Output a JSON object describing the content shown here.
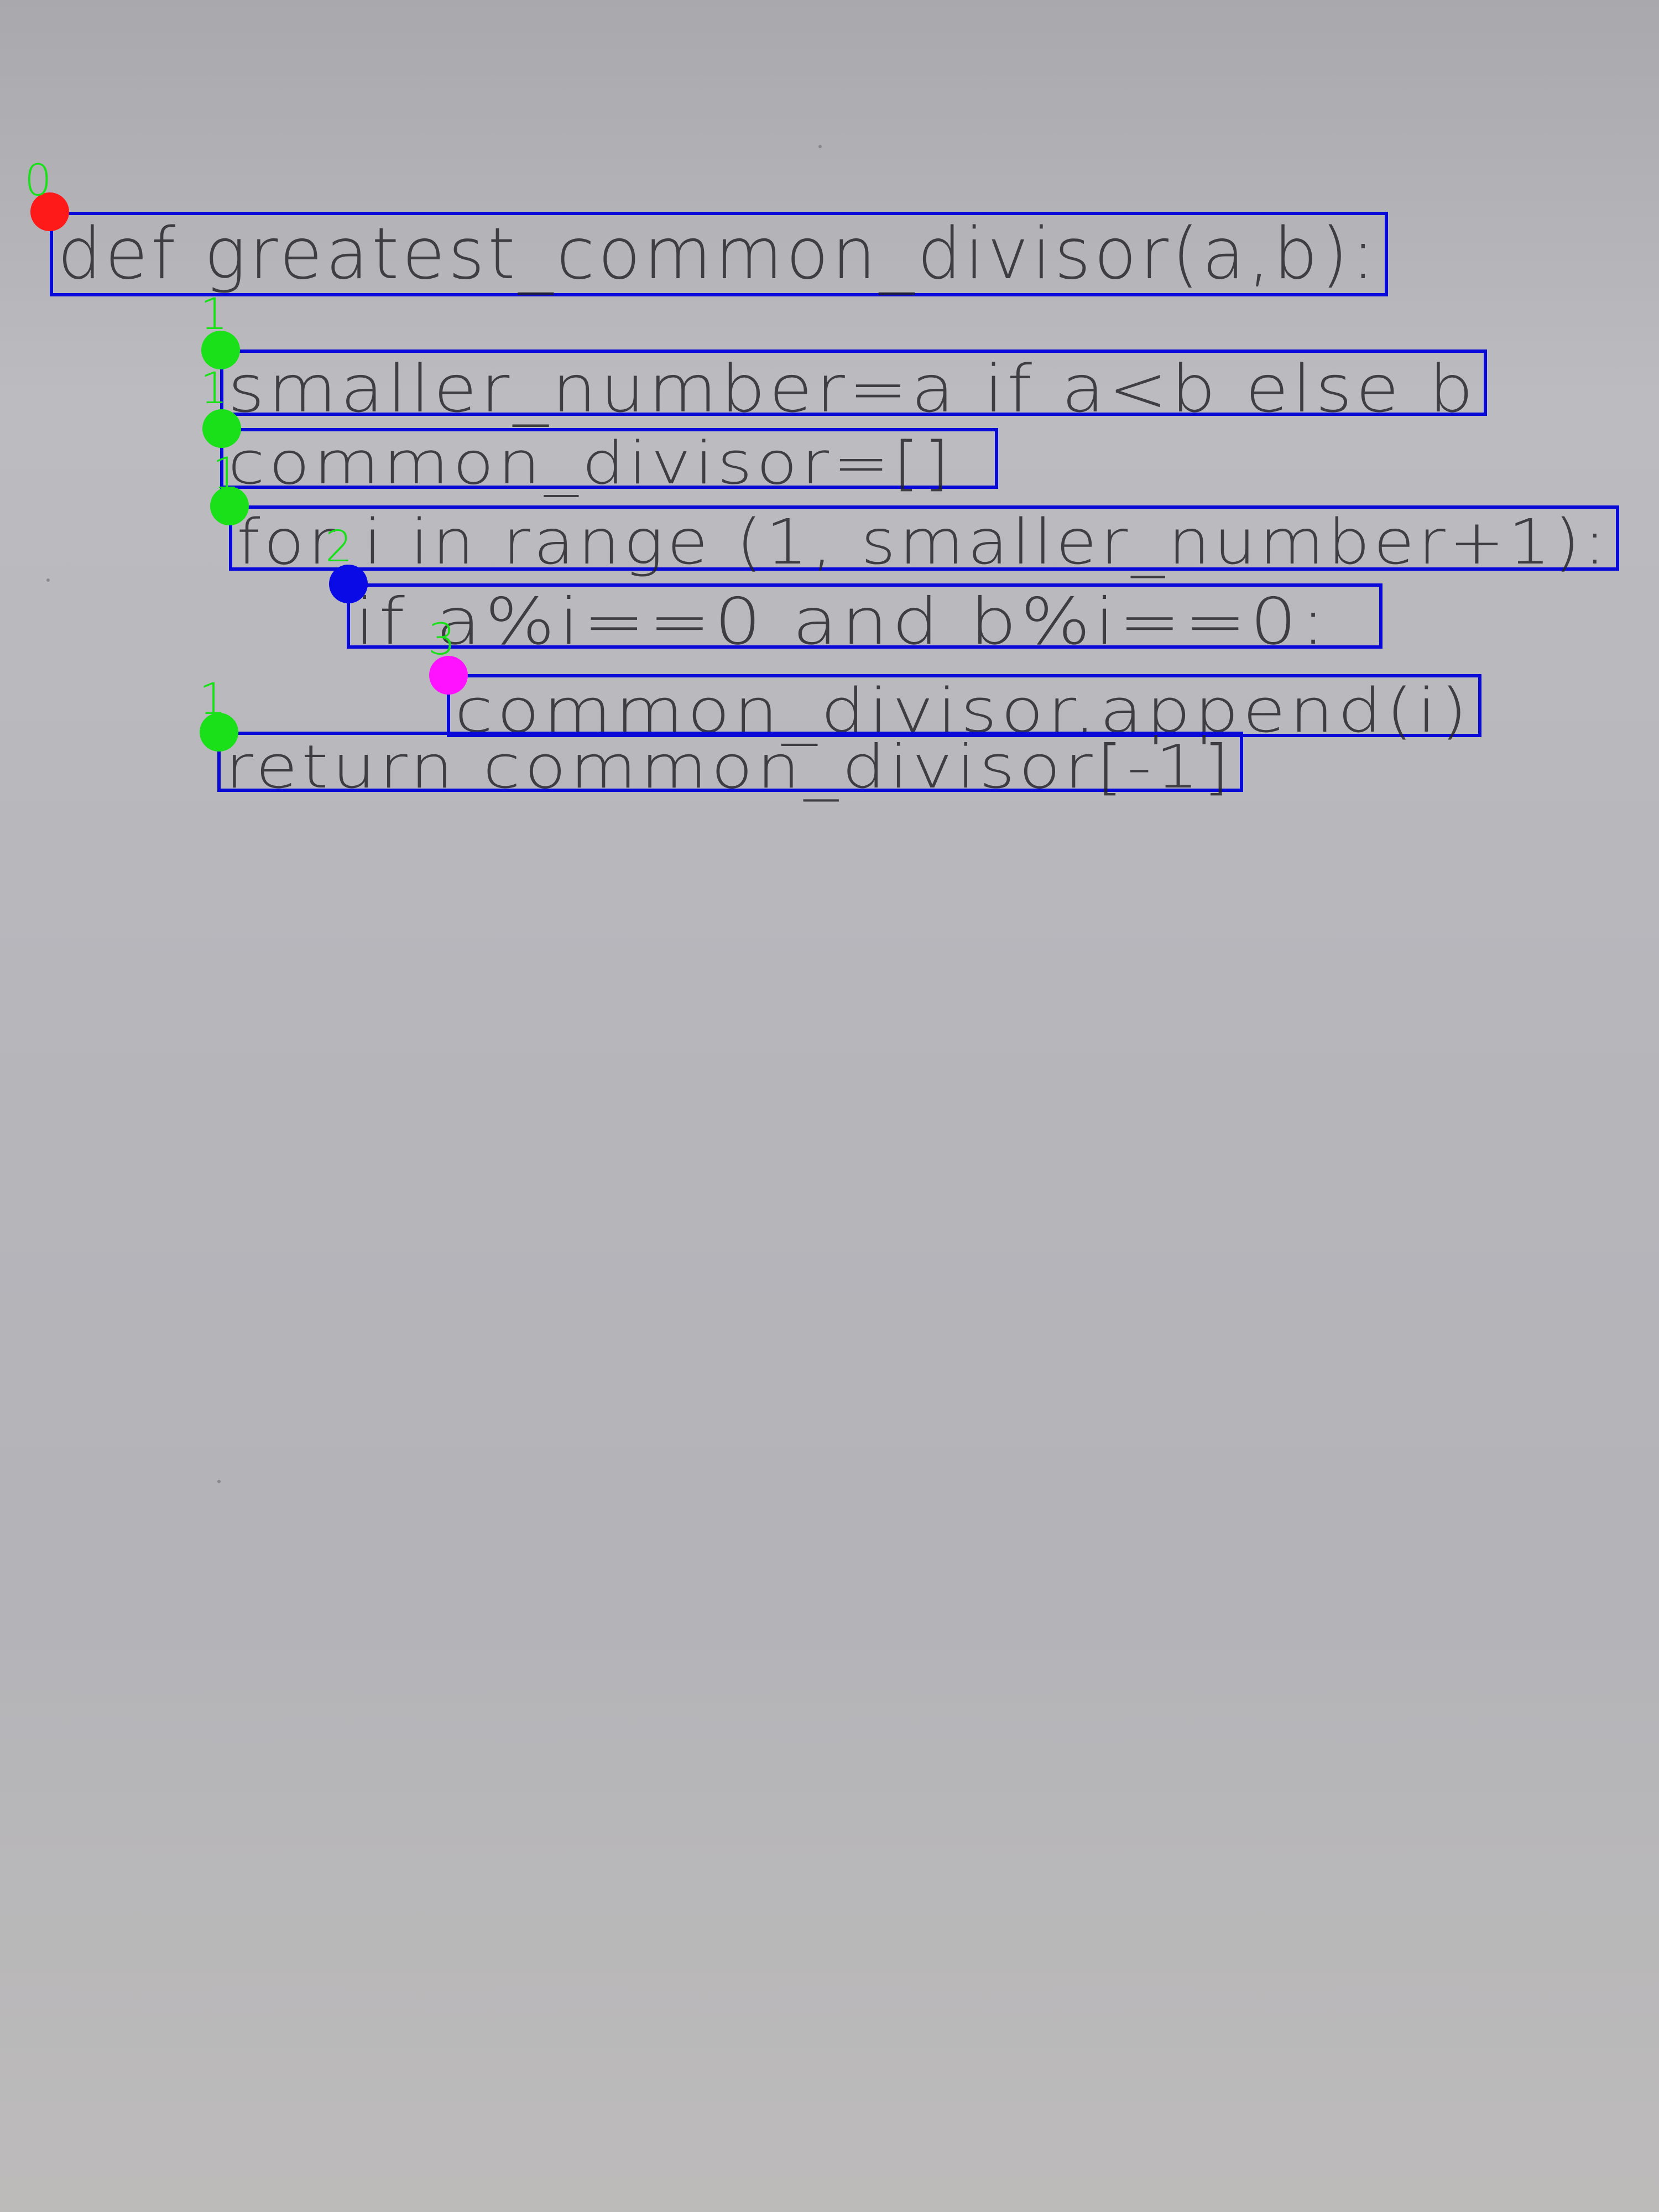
{
  "document": {
    "lines": [
      {
        "text": "def greatest_common_divisor(a,b):",
        "indent_level": "0",
        "marker_color": "#ff1a1a"
      },
      {
        "text": "smaller_number=a if a<b else b",
        "indent_level": "1",
        "marker_color": "#19e019"
      },
      {
        "text": "common_divisor=[]",
        "indent_level": "1",
        "marker_color": "#19e019"
      },
      {
        "text": "for i in range (1, smaller_number+1):",
        "indent_level": "1",
        "marker_color": "#19e019"
      },
      {
        "text": "if a%i==0 and b%i==0:",
        "indent_level": "2",
        "marker_color": "#0a0ae6"
      },
      {
        "text": "common_divisor.append(i)",
        "indent_level": "3",
        "marker_color": "#ff12ff"
      },
      {
        "text": "return common_divisor[-1]",
        "indent_level": "1",
        "marker_color": "#19e019"
      }
    ],
    "box_color": "#0a0ad8",
    "label_color": "#19e019"
  }
}
